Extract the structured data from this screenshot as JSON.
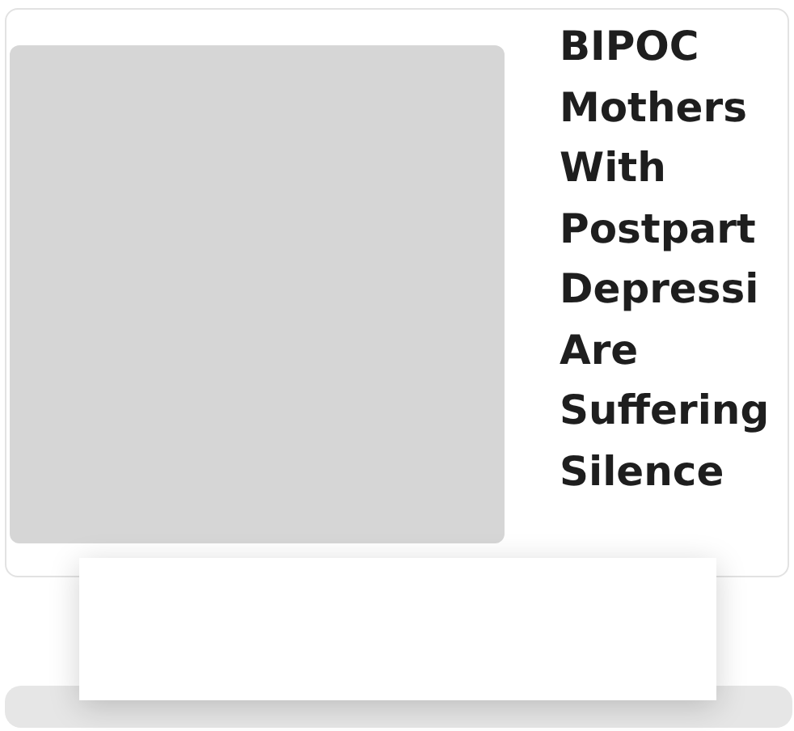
{
  "article_card": {
    "title_lines": [
      "BIPOC",
      "Mothers",
      "With",
      "Postpart",
      "Depressi",
      "Are",
      "Suffering",
      "Silence"
    ]
  }
}
